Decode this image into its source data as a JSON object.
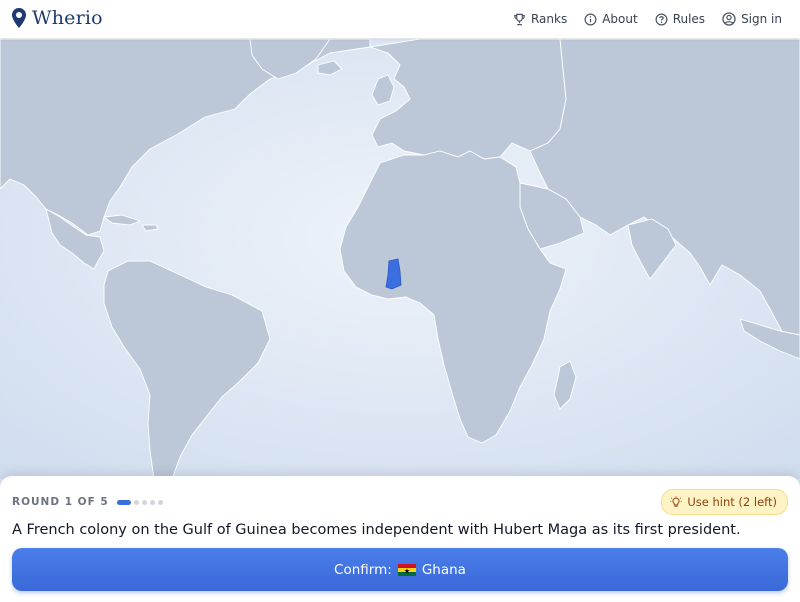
{
  "brand": {
    "name": "Wherio"
  },
  "nav": {
    "ranks": "Ranks",
    "about": "About",
    "rules": "Rules",
    "signin": "Sign in"
  },
  "map": {
    "highlighted_country": "Ghana",
    "highlight_color": "#3b6fe0",
    "land_color": "#bcc8d8",
    "ocean_color": "#dfe9f5"
  },
  "panel": {
    "round_label": "ROUND 1 OF 5",
    "round_current": 1,
    "round_total": 5,
    "hint_label": "Use hint (2 left)",
    "question": "A French colony on the Gulf of Guinea becomes independent with Hubert Maga as its first president.",
    "confirm_prefix": "Confirm:",
    "confirm_country": "Ghana"
  },
  "icons": {
    "brand": "map-pin-icon",
    "ranks": "trophy-icon",
    "about": "info-icon",
    "rules": "question-icon",
    "signin": "user-icon",
    "hint": "lightbulb-icon",
    "flag": "ghana-flag-icon"
  }
}
